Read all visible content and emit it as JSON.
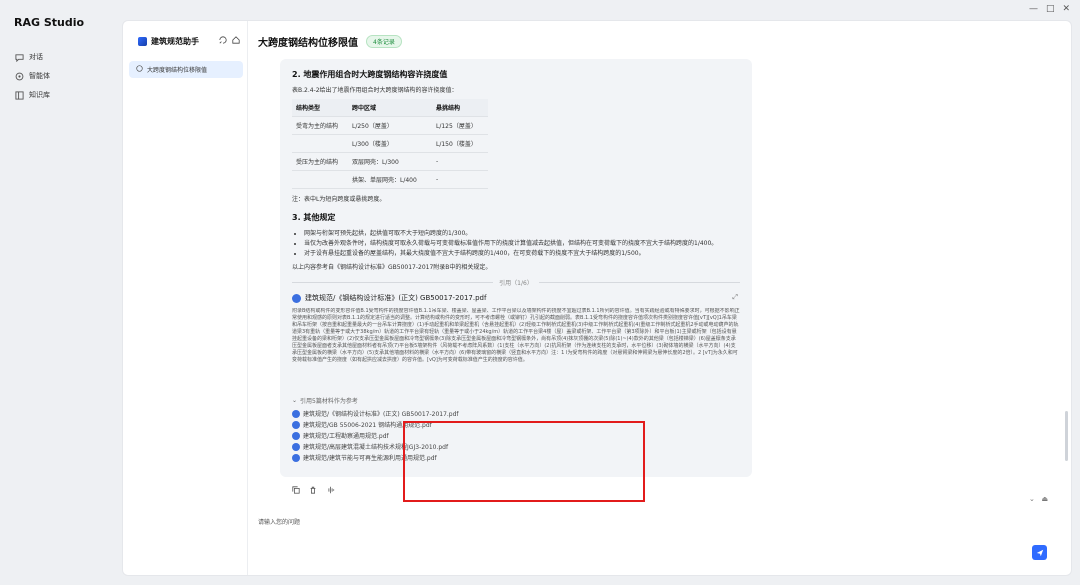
{
  "window": {
    "min": "—",
    "max": "□",
    "close": "✕"
  },
  "nav": {
    "brand": "RAG Studio",
    "items": [
      {
        "label": "对话",
        "icon": "chat-icon"
      },
      {
        "label": "智能体",
        "icon": "agent-icon"
      },
      {
        "label": "知识库",
        "icon": "knowledge-icon"
      }
    ]
  },
  "assistant": {
    "name": "建筑规范助手"
  },
  "conversations": [
    {
      "label": "大跨度钢结构位移限值"
    }
  ],
  "chat": {
    "title": "大跨度钢结构位移限值",
    "badge": "4条记录"
  },
  "message": {
    "section2_title": "2. 地震作用组合时大跨度钢结构容许挠度值",
    "table_intro": "表B.2.4-2给出了地震作用组合时大跨度钢结构的容许挠度值：",
    "table": {
      "headers": [
        "结构类型",
        "跨中区域",
        "悬挑结构"
      ],
      "rows": [
        [
          "受弯为主的结构",
          "L/250（屋盖）",
          "L/125（屋盖）"
        ],
        [
          "",
          "L/300（楼盖）",
          "L/150（楼盖）"
        ],
        [
          "受压为主的结构",
          "双层网壳：L/300",
          "-"
        ],
        [
          "",
          "拱架、单层网壳：L/400",
          "-"
        ]
      ]
    },
    "table_note": "注：表中L为短向跨度或悬挑跨度。",
    "section3_title": "3. 其他规定",
    "bullets": [
      "网架与桁架可预先起拱，起拱值可取不大于短向跨度的1/300。",
      "当仅为改善外观条件时，结构挠度可取永久荷载与可变荷载标准值作用下的挠度计算值减去起拱值，但结构在可变荷载下的挠度不宜大于结构跨度的1/400。",
      "对于设有悬挂起重设备的屋盖结构，其最大挠度值不宜大于结构跨度的1/400，在可变荷载下的挠度不宜大于结构跨度的1/500。"
    ],
    "conclusion": "以上内容参考自《钢结构设计标准》GB50017-2017附录B中的相关规定。",
    "cite_divider": "引用（1/6）",
    "cite_title": "建筑规范/《钢结构设计标准》(正文) GB50017-2017.pdf",
    "excerpt": "附录B结构或构件的变形容许值B.1受弯构件的挠度容许值B.1.1吊车梁、楼盖梁、屋盖梁、工作平台梁以及墙架构件的挠度不宜超过表B.1.1所列的容许值。当有实践经验或有特殊要求时，可根据不影响正常使用和观感的原则对表B.1.1的规定进行适当的调整。计算结构或构件的变形时，可不考虑螺栓（或铆钉）孔引起的截面削弱。表B.1.1受弯构件的挠度容许值项次构件类别挠度容许值[vT][vQ]1吊车梁和吊车桁架（按自重和起重量最大的一台吊车计算挠度）(1)手动起重机和单梁起重机（含悬挂起重机）(2)轻级工作制桥式起重机(3)中级工作制桥式起重机(4)重级工作制桥式起重机2手动或电动葫芦的轨道梁3有重轨（重量等于或大于38kg/m）轨道的工作平台梁有轻轨（重量等于或小于24kg/m）轨道的工作平台梁4楼（屋）盖梁或桁架、工作平台梁（第3项除外）和平台板(1)主梁或桁架（包括设有悬挂起重设备的梁和桁架）(2)仅支承压型金属板屋面和冷弯型钢檩条(3)除支承压型金属板屋面和冷弯型钢檩条外，尚有吊顶(4)抹灰顶棚的次梁(5)除(1)~(4)款外的其他梁（包括楼梯梁）(6)屋盖檩条支承压型金属板屋面者支承其他屋面材料者有吊顶(7)平台板5墙架构件（风荷载不考虑阵风系数）(1)支柱（水平方向）(2)抗风桁架（作为连续支柱的支承时，水平位移）(3)砌体墙的横梁（水平方向）(4)支承压型金属板的横梁（水平方向）(5)支承其他墙面材料的横梁（水平方向）(6)带有玻璃窗的横梁（竖直和水平方向）注：1 l为受弯构件的跨度（对悬臂梁和伸臂梁为悬伸长度的2倍）。2 [vT]为永久和可变荷载标准值产生的挠度（如有起拱应减去拱度）的容许值。[vQ]为可变荷载标准值产生的挠度的容许值。",
    "refs_header": "引用5篇材料作为参考",
    "refs": [
      "建筑规范/《钢结构设计标准》(正文) GB50017-2017.pdf",
      "建筑规范/GB 55006-2021 钢结构通用规范.pdf",
      "建筑规范/工程勘察通用规范.pdf",
      "建筑规范/高层建筑混凝土结构技术规程JGJ3-2010.pdf",
      "建筑规范/建筑节能与可再生能源利用通用规范.pdf"
    ]
  },
  "input": {
    "placeholder": "请输入您的问题"
  }
}
